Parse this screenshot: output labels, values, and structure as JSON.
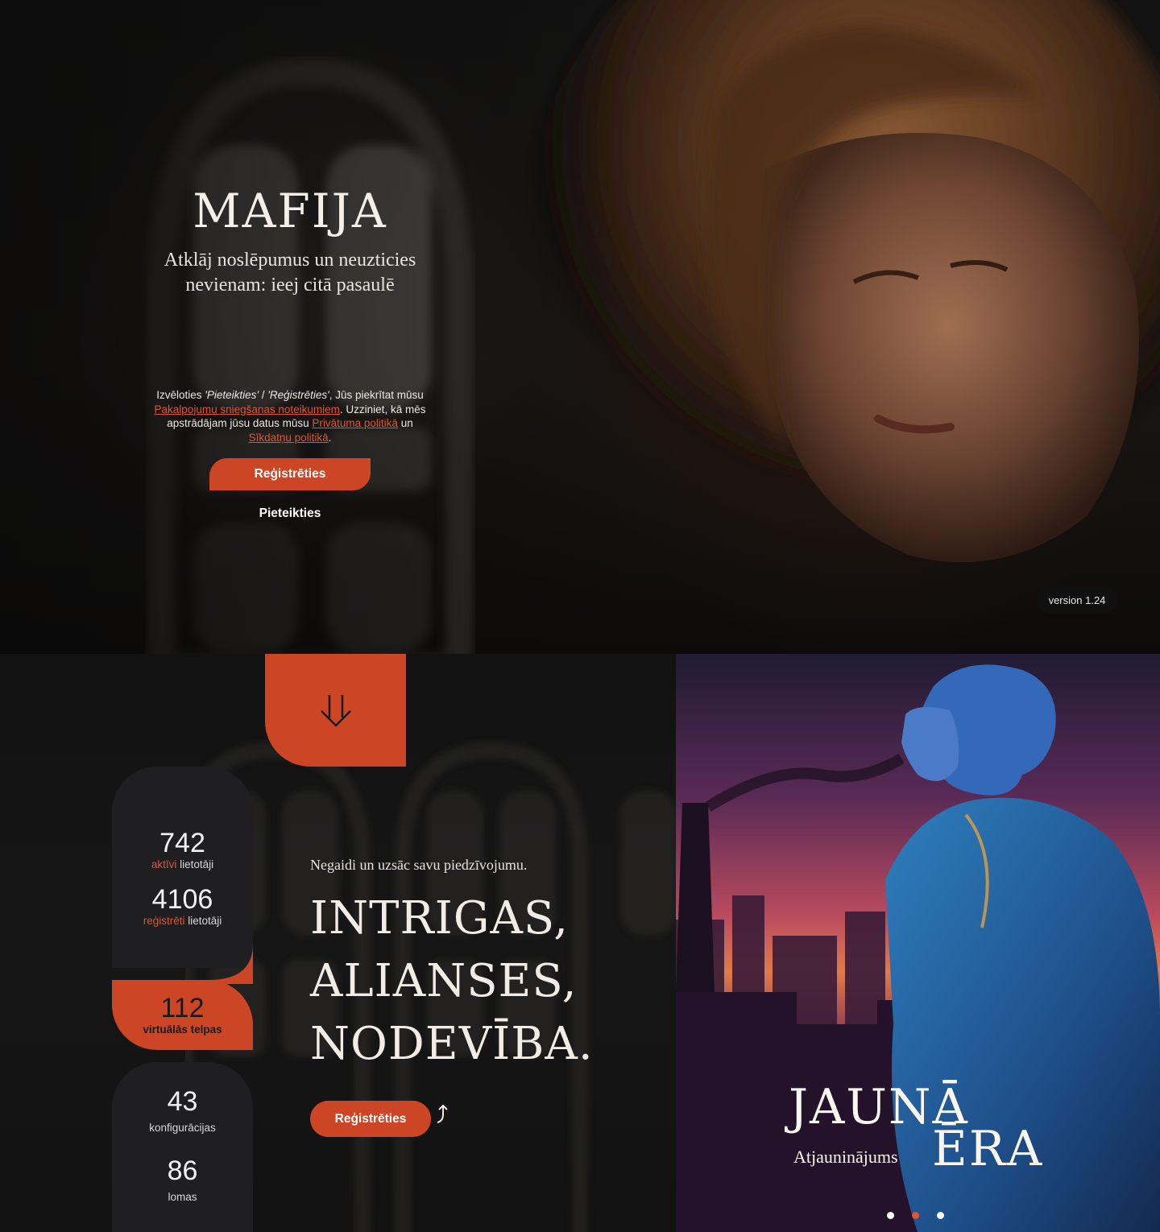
{
  "hero": {
    "title": "MAFIJA",
    "tagline": "Atklāj noslēpumus un neuzticies nevienam: ieej citā pasaulē",
    "consent": {
      "part1": "Izvēloties ",
      "option_login": "'Pieteikties'",
      "sep": " / ",
      "option_register": "'Reģistrēties'",
      "part2": ", Jūs piekrītat mūsu ",
      "terms_link": "Pakalpojumu sniegšanas noteikumiem",
      "part3": ". Uzziniet, kā mēs apstrādājam jūsu datus mūsu ",
      "privacy_link": "Privātuma politikā",
      "part4": " un ",
      "cookies_link": "Sīkdatņu politikā",
      "part5": "."
    },
    "register_label": "Reģistrēties",
    "login_label": "Pieteikties",
    "version": "version 1.24"
  },
  "stats": {
    "active_users": {
      "value": "742",
      "accent": "aktīvi",
      "label": " lietotāji"
    },
    "registered_users": {
      "value": "4106",
      "accent": "reģistrēti",
      "label": " lietotāji"
    },
    "rooms": {
      "value": "112",
      "label": "virtuālās telpas"
    },
    "configs": {
      "value": "43",
      "label": "konfigurācijas"
    },
    "roles": {
      "value": "86",
      "label": "lomas"
    }
  },
  "promo_main": {
    "kicker": "Negaidi un uzsāc savu piedzīvojumu.",
    "headline": [
      "INTRIGAS,",
      "ALIANSES,",
      "NODEVĪBA."
    ],
    "register_label": "Reģistrēties"
  },
  "update_banner": {
    "title_line1": "JAUNĀ",
    "title_line2": "ĒRA",
    "subtitle": "Atjauninājums",
    "slides": 3,
    "active_slide": 2
  },
  "colors": {
    "accent": "#cc4626",
    "link": "#e0542f",
    "card": "#1f1f21",
    "background": "#121212"
  },
  "icons": [
    "double-arrow-down-icon",
    "arrow-up-right-icon"
  ]
}
